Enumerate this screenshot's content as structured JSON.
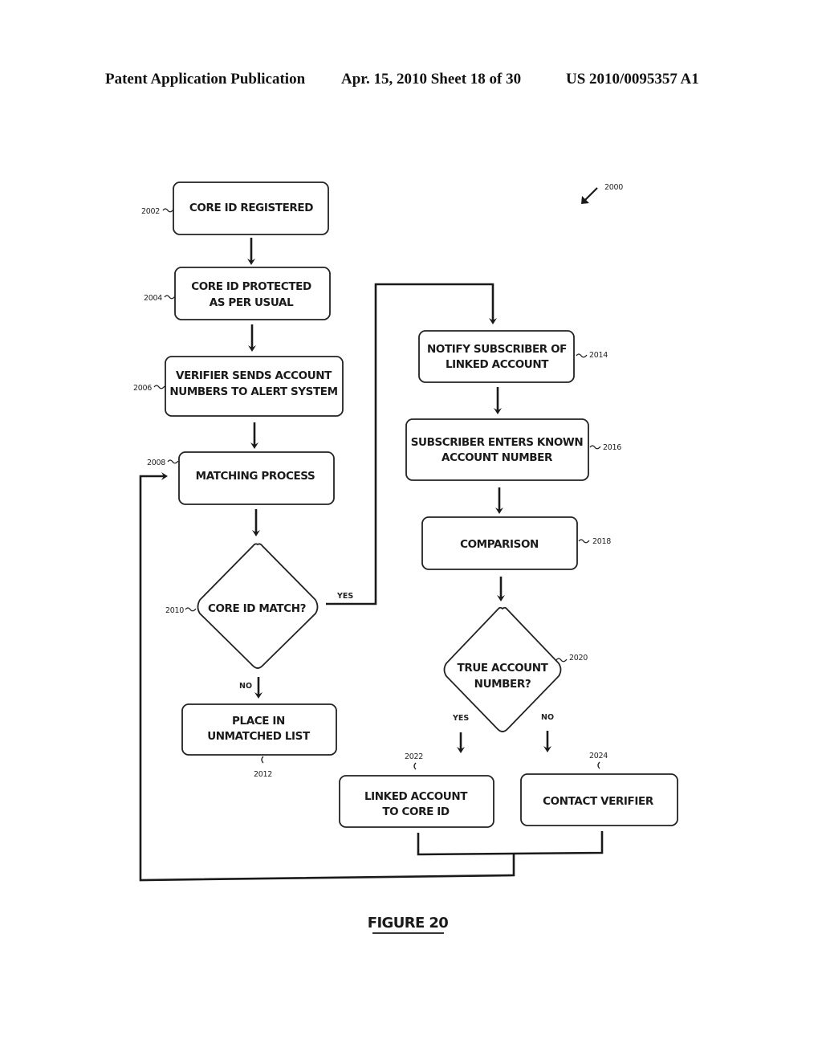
{
  "header": {
    "publication": "Patent Application Publication",
    "date_sheet": "Apr. 15, 2010  Sheet 18 of 30",
    "number": "US 2010/0095357 A1"
  },
  "figure": {
    "ref": "2000",
    "caption": "FIGURE 20",
    "nodes": {
      "n2002": {
        "ref": "2002",
        "line1": "CORE ID REGISTERED",
        "line2": ""
      },
      "n2004": {
        "ref": "2004",
        "line1": "CORE ID PROTECTED",
        "line2": "AS PER USUAL"
      },
      "n2006": {
        "ref": "2006",
        "line1": "VERIFIER SENDS ACCOUNT",
        "line2": "NUMBERS TO ALERT SYSTEM"
      },
      "n2008": {
        "ref": "2008",
        "line1": "MATCHING PROCESS",
        "line2": ""
      },
      "n2010": {
        "ref": "2010",
        "line1": "CORE ID MATCH?",
        "line2": ""
      },
      "n2012": {
        "ref": "2012",
        "line1": "PLACE IN",
        "line2": "UNMATCHED LIST"
      },
      "n2014": {
        "ref": "2014",
        "line1": "NOTIFY SUBSCRIBER OF",
        "line2": "LINKED ACCOUNT"
      },
      "n2016": {
        "ref": "2016",
        "line1": "SUBSCRIBER ENTERS KNOWN",
        "line2": "ACCOUNT NUMBER"
      },
      "n2018": {
        "ref": "2018",
        "line1": "COMPARISON",
        "line2": ""
      },
      "n2020": {
        "ref": "2020",
        "line1": "TRUE ACCOUNT",
        "line2": "NUMBER?"
      },
      "n2022": {
        "ref": "2022",
        "line1": "LINKED ACCOUNT",
        "line2": "TO CORE ID"
      },
      "n2024": {
        "ref": "2024",
        "line1": "CONTACT VERIFIER",
        "line2": ""
      }
    },
    "edge_labels": {
      "match_yes": "YES",
      "match_no": "NO",
      "true_yes": "YES",
      "true_no": "NO"
    }
  }
}
